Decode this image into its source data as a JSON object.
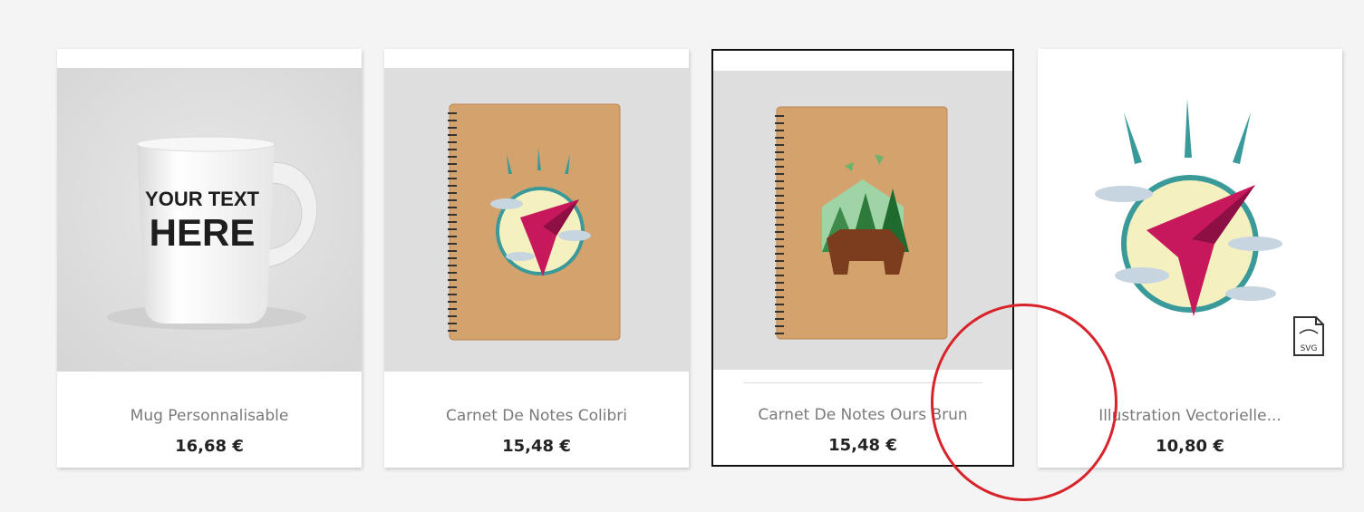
{
  "products": [
    {
      "name": "Mug Personnalisable",
      "price": "16,68 €",
      "image": "white-mug-image",
      "mug_text": [
        "YOUR TEXT",
        "HERE"
      ]
    },
    {
      "name": "Carnet De Notes Colibri",
      "price": "15,48 €",
      "image": "kraft-notebook-hummingbird-image"
    },
    {
      "name": "Carnet De Notes Ours Brun",
      "price": "15,48 €",
      "image": "kraft-notebook-brown-bear-image",
      "state": "hovered"
    },
    {
      "name": "Illustration Vectorielle...",
      "price": "10,80 €",
      "image": "hummingbird-illustration-image",
      "badge": "SVG"
    }
  ],
  "colors": {
    "page_bg": "#f4f4f4",
    "card_bg": "#ffffff",
    "thumb_bg": "#dedede",
    "price_text": "#232323",
    "name_text": "#7a7a7a",
    "annotation": "#d8232a",
    "kraft": "#d4a26c",
    "teal": "#3a9a9a",
    "magenta": "#c8185c",
    "sun": "#f5f0c0"
  }
}
